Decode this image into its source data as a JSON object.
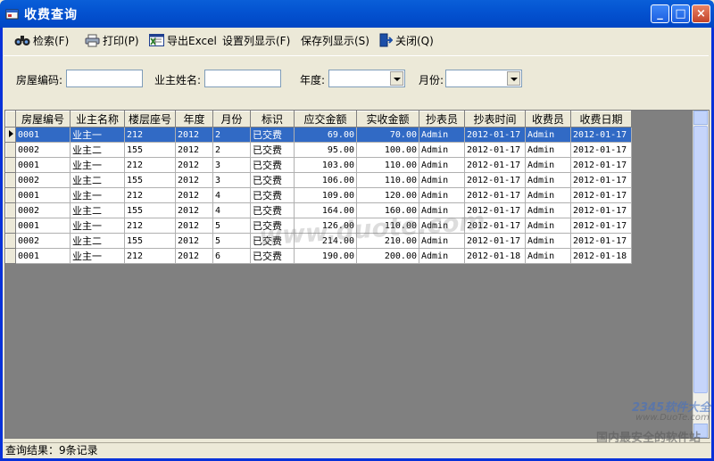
{
  "window": {
    "title": "收费查询"
  },
  "toolbar": {
    "search": "检索(F)",
    "print": "打印(P)",
    "export": "导出Excel",
    "set_columns": "设置列显示(F)",
    "save_columns": "保存列显示(S)",
    "close": "关闭(Q)"
  },
  "filters": {
    "house_code_label": "房屋编码:",
    "house_code_value": "",
    "owner_name_label": "业主姓名:",
    "owner_name_value": "",
    "year_label": "年度:",
    "year_value": "",
    "month_label": "月份:",
    "month_value": ""
  },
  "table": {
    "columns": [
      "房屋编号",
      "业主名称",
      "楼层座号",
      "年度",
      "月份",
      "标识",
      "应交金额",
      "实收金额",
      "抄表员",
      "抄表时间",
      "收费员",
      "收费日期"
    ],
    "rows": [
      [
        "0001",
        "业主一",
        "212",
        "2012",
        "2",
        "已交费",
        "69.00",
        "70.00",
        "Admin",
        "2012-01-17",
        "Admin",
        "2012-01-17"
      ],
      [
        "0002",
        "业主二",
        "155",
        "2012",
        "2",
        "已交费",
        "95.00",
        "100.00",
        "Admin",
        "2012-01-17",
        "Admin",
        "2012-01-17"
      ],
      [
        "0001",
        "业主一",
        "212",
        "2012",
        "3",
        "已交费",
        "103.00",
        "110.00",
        "Admin",
        "2012-01-17",
        "Admin",
        "2012-01-17"
      ],
      [
        "0002",
        "业主二",
        "155",
        "2012",
        "3",
        "已交费",
        "106.00",
        "110.00",
        "Admin",
        "2012-01-17",
        "Admin",
        "2012-01-17"
      ],
      [
        "0001",
        "业主一",
        "212",
        "2012",
        "4",
        "已交费",
        "109.00",
        "120.00",
        "Admin",
        "2012-01-17",
        "Admin",
        "2012-01-17"
      ],
      [
        "0002",
        "业主二",
        "155",
        "2012",
        "4",
        "已交费",
        "164.00",
        "160.00",
        "Admin",
        "2012-01-17",
        "Admin",
        "2012-01-17"
      ],
      [
        "0001",
        "业主一",
        "212",
        "2012",
        "5",
        "已交费",
        "126.00",
        "110.00",
        "Admin",
        "2012-01-17",
        "Admin",
        "2012-01-17"
      ],
      [
        "0002",
        "业主二",
        "155",
        "2012",
        "5",
        "已交费",
        "214.00",
        "210.00",
        "Admin",
        "2012-01-17",
        "Admin",
        "2012-01-17"
      ],
      [
        "0001",
        "业主一",
        "212",
        "2012",
        "6",
        "已交费",
        "190.00",
        "200.00",
        "Admin",
        "2012-01-18",
        "Admin",
        "2012-01-18"
      ]
    ],
    "selected_row": 0
  },
  "status": {
    "text": "查询结果：9条记录"
  },
  "watermark": {
    "center": "www.duote.com",
    "logo_brand": "2345软件大全",
    "logo_url": "www.DuoTe.com",
    "logo_slogan": "国内最安全的软件站"
  },
  "colors": {
    "titlebar": "#0453d1",
    "selection": "#316ac5",
    "face": "#ece9d8"
  }
}
